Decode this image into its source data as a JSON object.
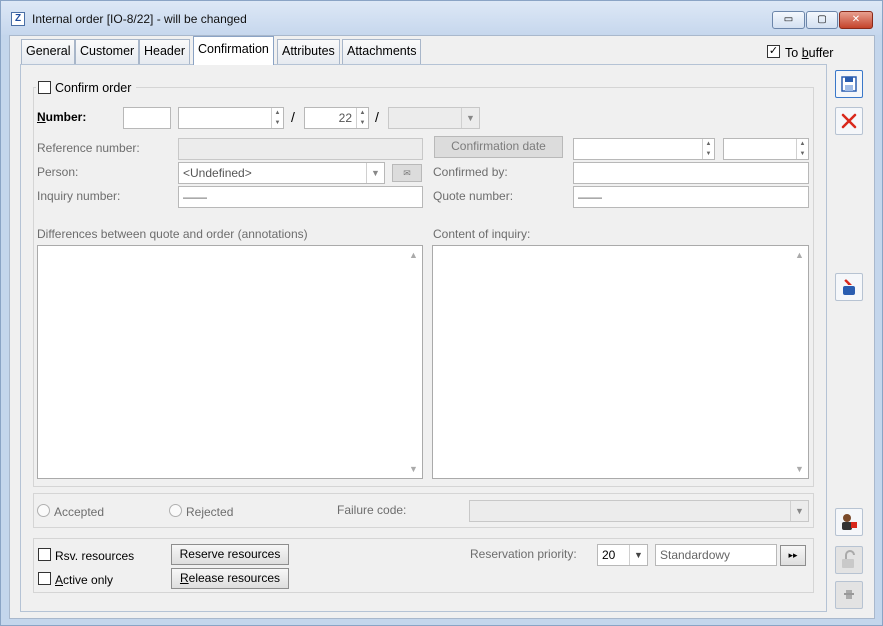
{
  "window": {
    "title": "Internal order [IO-8/22] - will be changed",
    "app_icon_letter": "Z",
    "controls": {
      "minimize": "▭",
      "maximize": "▢",
      "close": "✕"
    }
  },
  "tabs": [
    {
      "label": "General"
    },
    {
      "label": "Customer"
    },
    {
      "label": "Header"
    },
    {
      "label": "Confirmation"
    },
    {
      "label": "Attributes"
    },
    {
      "label": "Attachments"
    }
  ],
  "to_buffer": {
    "label_pre": "To ",
    "label_ul": "b",
    "label_post": "uffer",
    "checked": "✓"
  },
  "confirm_order": {
    "label": "Confirm order"
  },
  "number": {
    "label_pre": "",
    "label_ul": "N",
    "label_post": "umber:",
    "prefix": "",
    "main": "",
    "year": "22",
    "series": "",
    "slash": "/"
  },
  "reference_number": {
    "label": "Reference number:",
    "value": ""
  },
  "confirmation_date": {
    "button": "Confirmation date",
    "date": "",
    "time": ""
  },
  "person": {
    "label": "Person:",
    "value": "<Undefined>"
  },
  "confirmed_by": {
    "label": "Confirmed by:",
    "value": ""
  },
  "inquiry_number": {
    "label": "Inquiry number:",
    "value": "——"
  },
  "quote_number": {
    "label": "Quote number:",
    "value": "——"
  },
  "differences": {
    "label": "Differences between quote and order (annotations)"
  },
  "content_of_inquiry": {
    "label": "Content of inquiry:"
  },
  "status": {
    "accepted": "Accepted",
    "rejected": "Rejected",
    "failure_code_label": "Failure code:",
    "failure_code_value": ""
  },
  "resources": {
    "rsv_label": "Rsv. resources",
    "active_only_pre": "",
    "active_only_ul": "A",
    "active_only_post": "ctive only",
    "reserve_button": "Reserve resources",
    "release_pre": "",
    "release_ul": "R",
    "release_post": "elease resources",
    "priority_label": "Reservation priority:",
    "priority_value": "20",
    "priority_name": "Standardowy",
    "next_symbol": "▸▸"
  },
  "colors": {
    "save_blue": "#2a5db0",
    "delete_red": "#d9281c",
    "accent_border": "#3a78c9"
  }
}
